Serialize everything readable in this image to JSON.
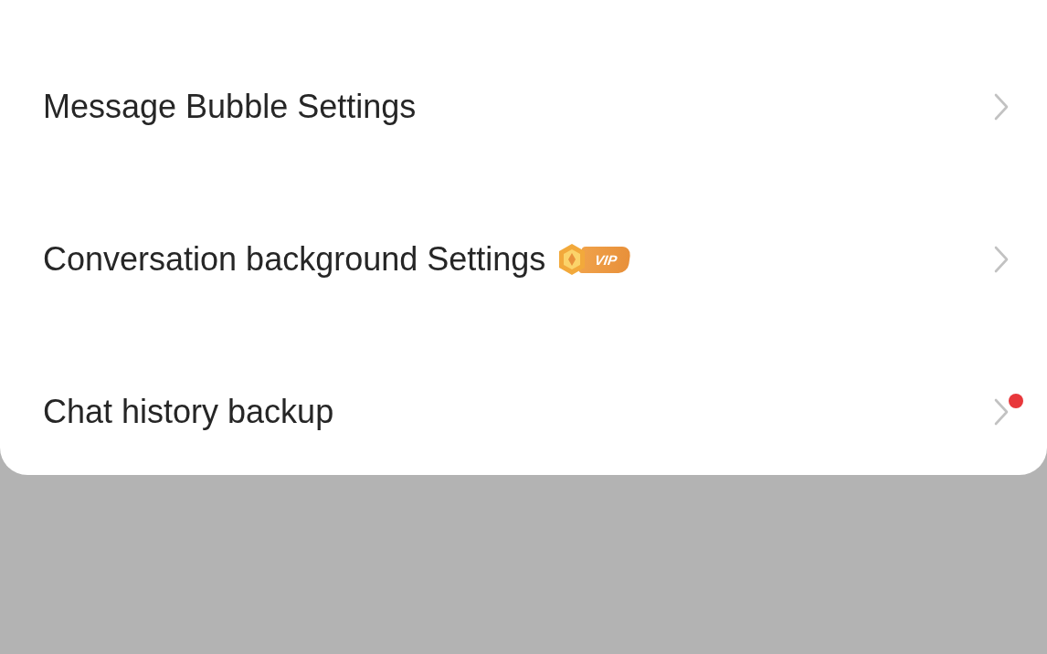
{
  "settings_items": [
    {
      "label": "Message Bubble Settings",
      "new_dot": false
    },
    {
      "label": "Conversation background Settings",
      "vip_badge": "VIP",
      "new_dot": false
    },
    {
      "label": "Chat history backup",
      "new_dot": true
    }
  ]
}
